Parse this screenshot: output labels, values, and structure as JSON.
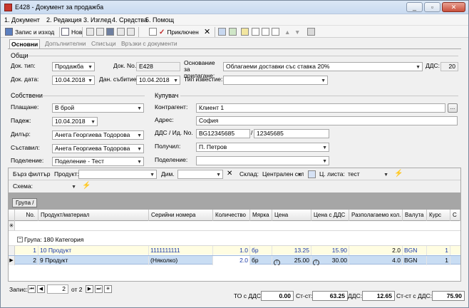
{
  "window": {
    "title": "E428 - Документ за продажба"
  },
  "menu": [
    "1. Документ",
    "2. Редакция",
    "3. Изглед",
    "4. Средства",
    "5. Помощ"
  ],
  "toolbar": {
    "save_exit": "Запис и изход",
    "new": "Нов",
    "post": "Приключен"
  },
  "tabs": [
    "Основни",
    "Допълнителни",
    "Списъци",
    "Връзки с документи"
  ],
  "general": {
    "section": "Общи",
    "doc_type_label": "Док. тип:",
    "doc_type": "Продажба",
    "doc_no_label": "Док. No.",
    "doc_no": "E428",
    "doc_date_label": "Док. дата:",
    "doc_date": "10.04.2018",
    "tax_date_label": "Дан. събитие:",
    "tax_date": "10.04.2018",
    "basis_label": "Основание за прилагане:",
    "basis": "Облагаеми доставки със ставка 20%",
    "vat_label": "ДДС:",
    "vat": "20",
    "notice_label": "Тип известие:",
    "notice": ""
  },
  "own": {
    "section": "Собствени",
    "payment_label": "Плащане:",
    "payment": "В брой",
    "due_label": "Падеж:",
    "due": "10.04.2018",
    "dealer_label": "Дилър:",
    "dealer": "Анета Георгиева Тодорова",
    "author_label": "Съставил:",
    "author": "Анета Георгиева Тодорова",
    "division_label": "Поделение:",
    "division": "Поделение - Тест"
  },
  "buyer": {
    "section": "Купувач",
    "partner_label": "Контрагент:",
    "partner": "Клиент 1",
    "address_label": "Адрес:",
    "address": "София",
    "vat_id_label": "ДДС / Ид. No.",
    "vat_no": "BG12345685",
    "id_no": "12345685",
    "receiver_label": "Получил:",
    "receiver": "П. Петров",
    "division_label": "Поделение:",
    "division": ""
  },
  "filter": {
    "quick_label": "Бърз филтър",
    "product_label": "Продукт:",
    "dim_label": "Дим.",
    "warehouse_label": "Склад:",
    "warehouse": "Централен скл",
    "pricelist_label": "Ц. листа:",
    "pricelist": "тест",
    "scheme_label": "Схема:"
  },
  "group_chip": "Група /",
  "columns": [
    "No.",
    "Продукт/материал",
    "Серийни номера",
    "Количество",
    "Мярка",
    "Цена",
    "Цена с ДДС",
    "Разполагаемо кол.",
    "Валута",
    "Курс",
    "С"
  ],
  "group_row": "Група: 180 Категория",
  "rows": [
    {
      "no": "1",
      "product": "10 Продукт",
      "serial": "1111111111",
      "qty": "1.0",
      "unit": "бр",
      "price": "13.25",
      "price_vat": "15.90",
      "avail": "2.0",
      "currency": "BGN",
      "rate": "1"
    },
    {
      "no": "2",
      "product": "9 Продукт",
      "serial": "(Няколко)",
      "qty": "2.0",
      "unit": "бр",
      "price": "25.00",
      "price_vat": "30.00",
      "avail": "4.0",
      "currency": "BGN",
      "rate": "1"
    }
  ],
  "nav": {
    "label": "Запис:",
    "current": "2",
    "of": "от 2"
  },
  "totals": {
    "to_vat_label": "ТО с ДДС:",
    "to_vat": "0.00",
    "st_label": "Ст-ст:",
    "st": "63.25",
    "vat_label": "ДДС:",
    "vat": "12.65",
    "st_vat_label": "Ст-ст с ДДС:",
    "st_vat": "75.90"
  }
}
